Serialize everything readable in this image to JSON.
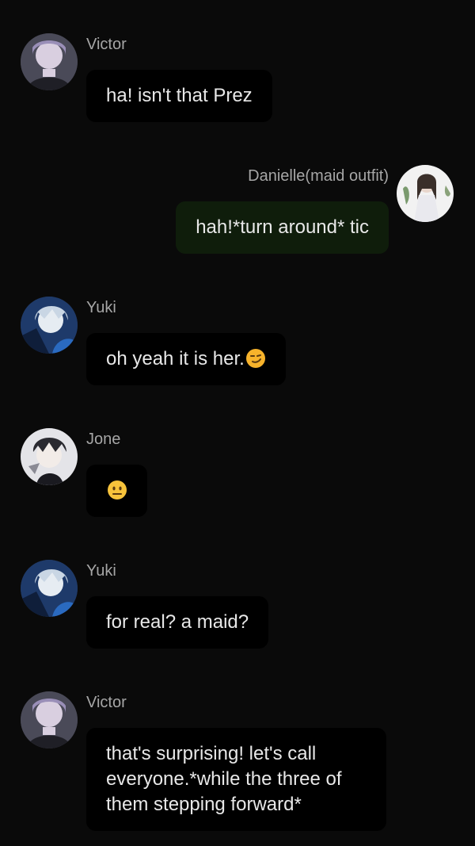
{
  "messages": [
    {
      "sender": "Victor",
      "text": "ha! isn't that Prez",
      "side": "left",
      "avatar": "victor-avatar"
    },
    {
      "sender": "Danielle(maid outfit)",
      "text": "hah!*turn around* tic",
      "side": "right",
      "avatar": "danielle-avatar"
    },
    {
      "sender": "Yuki",
      "text": "oh yeah it is her.",
      "emoji": "smirking-face-emoji",
      "side": "left",
      "avatar": "yuki-avatar"
    },
    {
      "sender": "Jone",
      "text": "",
      "emoji": "neutral-face-emoji",
      "side": "left",
      "avatar": "jone-avatar"
    },
    {
      "sender": "Yuki",
      "text": "for real? a maid?",
      "side": "left",
      "avatar": "yuki-avatar"
    },
    {
      "sender": "Victor",
      "text": "that's surprising! let's call everyone.*while the three of them stepping forward*",
      "side": "left",
      "avatar": "victor-avatar"
    }
  ],
  "colors": {
    "background": "#0a0a0a",
    "bubble": "#000000",
    "mine_bubble": "#0f1d0b",
    "name_text": "#a6a6a6",
    "message_text": "#e8e8e8"
  }
}
